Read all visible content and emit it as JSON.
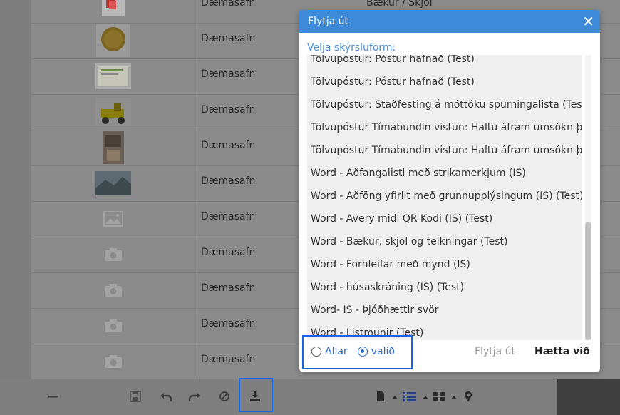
{
  "table": {
    "rows": [
      {
        "collection": "Dæmasafn",
        "category": "Bækur / Skjöl",
        "thumb": "image-book"
      },
      {
        "collection": "Dæmasafn",
        "category": "",
        "thumb": "image-coin"
      },
      {
        "collection": "Dæmasafn",
        "category": "",
        "thumb": "image-document"
      },
      {
        "collection": "Dæmasafn",
        "category": "",
        "thumb": "image-toycar"
      },
      {
        "collection": "Dæmasafn",
        "category": "",
        "thumb": "image-room"
      },
      {
        "collection": "Dæmasafn",
        "category": "",
        "thumb": "image-landscape"
      },
      {
        "collection": "Dæmasafn",
        "category": "",
        "thumb": "image-placeholder-icon"
      },
      {
        "collection": "Dæmasafn",
        "category": "",
        "thumb": "camera-icon"
      },
      {
        "collection": "Dæmasafn",
        "category": "",
        "thumb": "camera-icon"
      },
      {
        "collection": "Dæmasafn",
        "category": "",
        "thumb": "camera-icon"
      },
      {
        "collection": "Dæmasafn",
        "category": "",
        "thumb": "camera-icon"
      }
    ]
  },
  "dialog": {
    "title": "Flytja út",
    "subtitle": "Velja skýrsluform:",
    "items": [
      "Tölvupóstur: Póstur hafnað (Test)",
      "Tölvupóstur: Póstur hafnað (Test)",
      "Tölvupóstur: Staðfesting á móttöku spurningalista (Test)",
      "Tölvupóstur Tímabundin vistun: Haltu áfram umsókn þinni",
      "Tölvupóstur Tímabundin vistun: Haltu áfram umsókn þinni",
      "Word - Aðfangalisti með strikamerkjum (IS)",
      "Word - Aðföng yfirlit með grunnupplýsingum (IS) (Test)",
      "Word - Avery midi QR Kodi (IS) (Test)",
      "Word - Bækur, skjöl og teikningar (Test)",
      "Word - Fornleifar með mynd (IS)",
      "Word - húsaskráning (IS) (Test)",
      "Word- IS - Þjóðhættir svör",
      "Word - Listmunir (Test)"
    ],
    "radio_all": "Allar",
    "radio_selected": "valið",
    "export_button": "Flytja út",
    "cancel_button": "Hætta við"
  },
  "colors": {
    "header": "#3d8ad8",
    "accent": "#2b6cc9",
    "highlight": "#1763e6"
  }
}
